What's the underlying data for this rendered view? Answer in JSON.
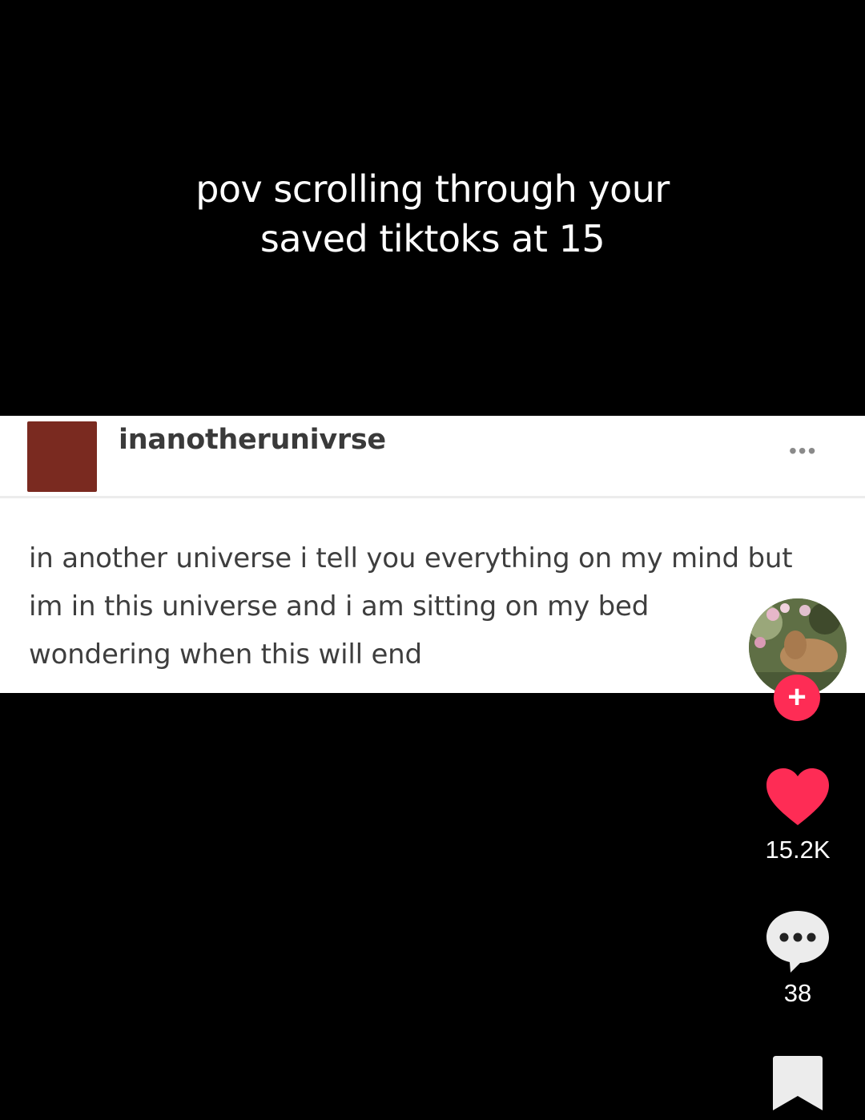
{
  "caption": {
    "line1": "pov scrolling through your",
    "line2": "saved tiktoks at 15"
  },
  "post": {
    "username": "inanotherunivrse",
    "more_label": "•••",
    "body_lines": [
      "in another universe i tell you everything on my mind but",
      "im in this universe and i am sitting on my bed",
      "wondering when this will end"
    ]
  },
  "sidebar": {
    "follow_label": "+",
    "like_count": "15.2K",
    "comment_count": "38",
    "icons": [
      "heart-icon",
      "comment-icon",
      "bookmark-icon"
    ]
  },
  "colors": {
    "background": "#000000",
    "accent": "#fe2c55",
    "post_avatar": "#7a2a20"
  }
}
